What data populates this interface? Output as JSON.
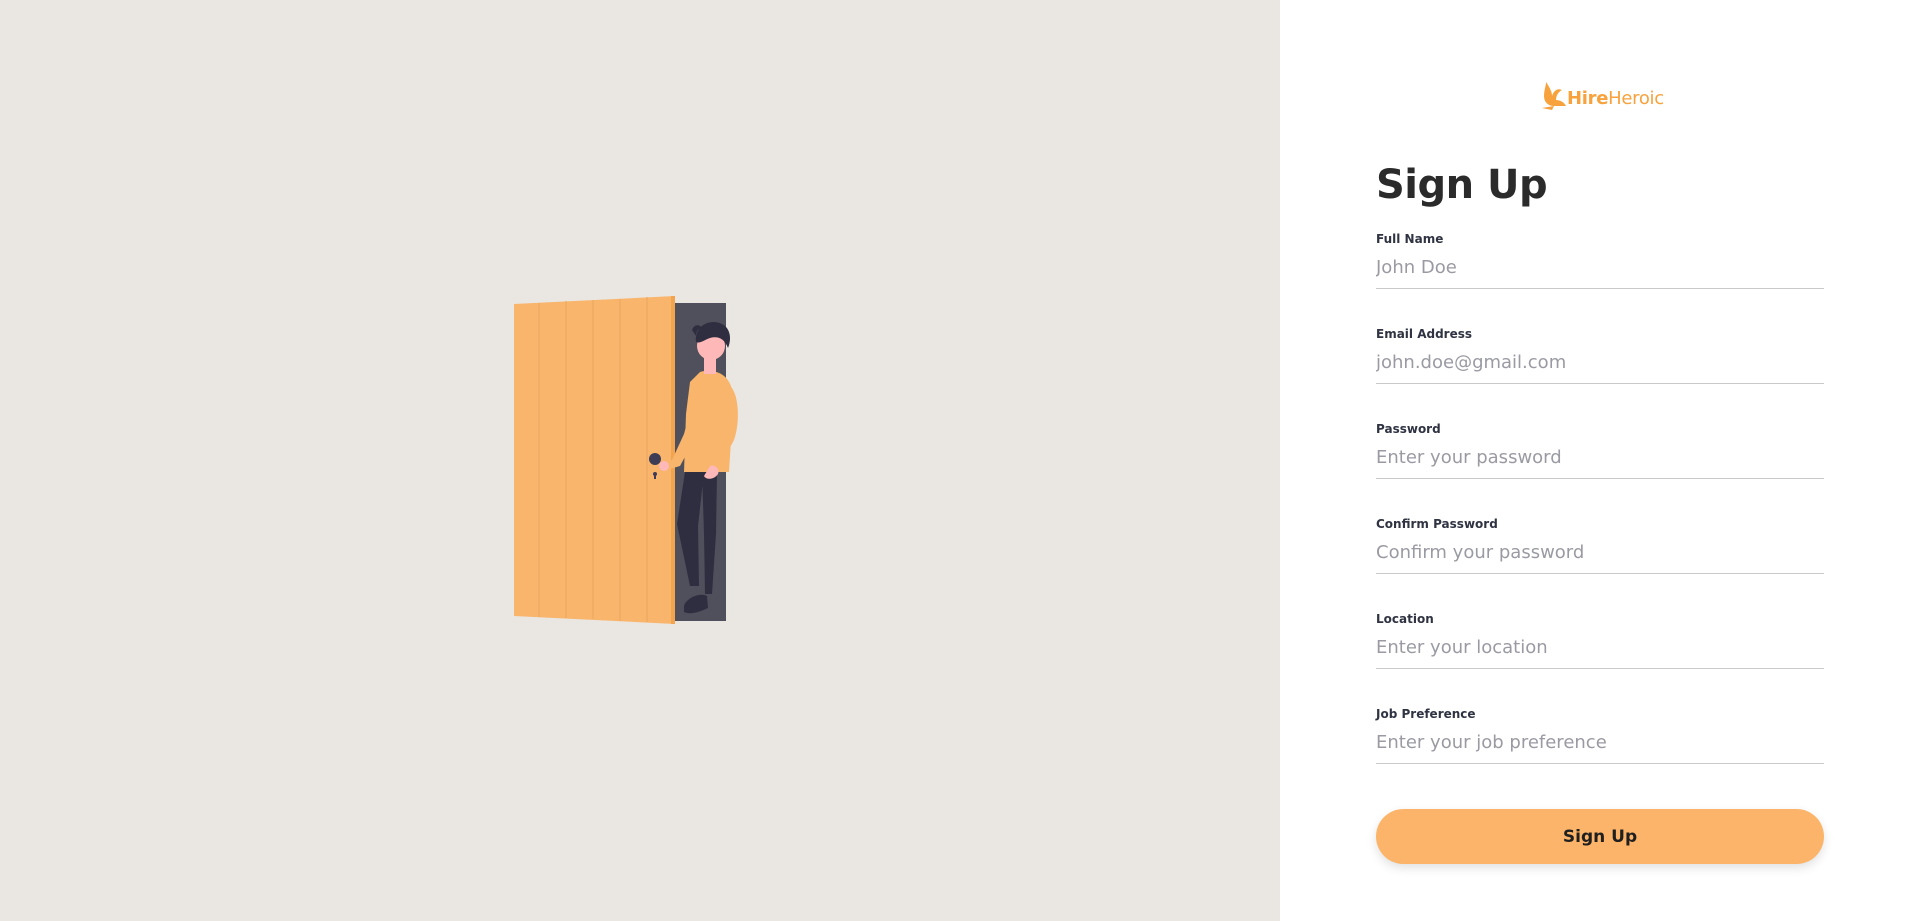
{
  "brand": {
    "name_part1": "Hire",
    "name_part2": "Heroic",
    "accent_color": "#f7a23c",
    "icon": "bird-logo-icon"
  },
  "illustration": {
    "icon": "person-opening-door-illustration",
    "background_color": "#eae6e1"
  },
  "form": {
    "title": "Sign Up",
    "fields": [
      {
        "label": "Full Name",
        "placeholder": "John Doe",
        "value": ""
      },
      {
        "label": "Email Address",
        "placeholder": "john.doe@gmail.com",
        "value": ""
      },
      {
        "label": "Password",
        "placeholder": "Enter your password",
        "value": ""
      },
      {
        "label": "Confirm Password",
        "placeholder": "Confirm your password",
        "value": ""
      },
      {
        "label": "Location",
        "placeholder": "Enter your location",
        "value": ""
      },
      {
        "label": "Job Preference",
        "placeholder": "Enter your job preference",
        "value": ""
      }
    ],
    "submit_label": "Sign Up",
    "button_color": "#fbb469"
  }
}
